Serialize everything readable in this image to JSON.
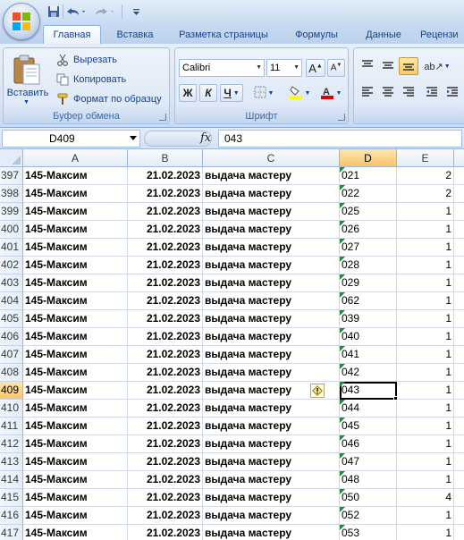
{
  "ribbon": {
    "tabs": [
      "Главная",
      "Вставка",
      "Разметка страницы",
      "Формулы",
      "Данные",
      "Рецензи"
    ],
    "clipboard": {
      "paste": "Вставить",
      "cut": "Вырезать",
      "copy": "Копировать",
      "format_painter": "Формат по образцу",
      "group_label": "Буфер обмена"
    },
    "font": {
      "name": "Calibri",
      "size": "11",
      "bold": "Ж",
      "italic": "К",
      "underline": "Ч",
      "group_label": "Шрифт",
      "fill_color": "#ffff00",
      "font_color": "#e00000"
    }
  },
  "formula_bar": {
    "name_box": "D409",
    "fx": "fx",
    "formula": "043"
  },
  "sheet": {
    "columns": [
      "A",
      "B",
      "C",
      "D",
      "E"
    ],
    "selected_column": "D",
    "selected_row": "409",
    "rows": [
      {
        "num": "397",
        "a": "145-Максим",
        "b": "21.02.2023",
        "c": "выдача мастеру",
        "d": "021",
        "e": "2"
      },
      {
        "num": "398",
        "a": "145-Максим",
        "b": "21.02.2023",
        "c": "выдача мастеру",
        "d": "022",
        "e": "2"
      },
      {
        "num": "399",
        "a": "145-Максим",
        "b": "21.02.2023",
        "c": "выдача мастеру",
        "d": "025",
        "e": "1"
      },
      {
        "num": "400",
        "a": "145-Максим",
        "b": "21.02.2023",
        "c": "выдача мастеру",
        "d": "026",
        "e": "1"
      },
      {
        "num": "401",
        "a": "145-Максим",
        "b": "21.02.2023",
        "c": "выдача мастеру",
        "d": "027",
        "e": "1"
      },
      {
        "num": "402",
        "a": "145-Максим",
        "b": "21.02.2023",
        "c": "выдача мастеру",
        "d": "028",
        "e": "1"
      },
      {
        "num": "403",
        "a": "145-Максим",
        "b": "21.02.2023",
        "c": "выдача мастеру",
        "d": "029",
        "e": "1"
      },
      {
        "num": "404",
        "a": "145-Максим",
        "b": "21.02.2023",
        "c": "выдача мастеру",
        "d": "062",
        "e": "1"
      },
      {
        "num": "405",
        "a": "145-Максим",
        "b": "21.02.2023",
        "c": "выдача мастеру",
        "d": "039",
        "e": "1"
      },
      {
        "num": "406",
        "a": "145-Максим",
        "b": "21.02.2023",
        "c": "выдача мастеру",
        "d": "040",
        "e": "1"
      },
      {
        "num": "407",
        "a": "145-Максим",
        "b": "21.02.2023",
        "c": "выдача мастеру",
        "d": "041",
        "e": "1"
      },
      {
        "num": "408",
        "a": "145-Максим",
        "b": "21.02.2023",
        "c": "выдача мастеру",
        "d": "042",
        "e": "1"
      },
      {
        "num": "409",
        "a": "145-Максим",
        "b": "21.02.2023",
        "c": "выдача мастеру",
        "d": "043",
        "e": "1"
      },
      {
        "num": "410",
        "a": "145-Максим",
        "b": "21.02.2023",
        "c": "выдача мастеру",
        "d": "044",
        "e": "1"
      },
      {
        "num": "411",
        "a": "145-Максим",
        "b": "21.02.2023",
        "c": "выдача мастеру",
        "d": "045",
        "e": "1"
      },
      {
        "num": "412",
        "a": "145-Максим",
        "b": "21.02.2023",
        "c": "выдача мастеру",
        "d": "046",
        "e": "1"
      },
      {
        "num": "413",
        "a": "145-Максим",
        "b": "21.02.2023",
        "c": "выдача мастеру",
        "d": "047",
        "e": "1"
      },
      {
        "num": "414",
        "a": "145-Максим",
        "b": "21.02.2023",
        "c": "выдача мастеру",
        "d": "048",
        "e": "1"
      },
      {
        "num": "415",
        "a": "145-Максим",
        "b": "21.02.2023",
        "c": "выдача мастеру",
        "d": "050",
        "e": "4"
      },
      {
        "num": "416",
        "a": "145-Максим",
        "b": "21.02.2023",
        "c": "выдача мастеру",
        "d": "052",
        "e": "1"
      },
      {
        "num": "417",
        "a": "145-Максим",
        "b": "21.02.2023",
        "c": "выдача мастеру",
        "d": "053",
        "e": "1"
      }
    ]
  },
  "icons": {
    "office": "office-logo-icon",
    "save": "save-icon",
    "undo": "undo-icon",
    "redo": "redo-icon",
    "warning": "error-warning-icon"
  }
}
